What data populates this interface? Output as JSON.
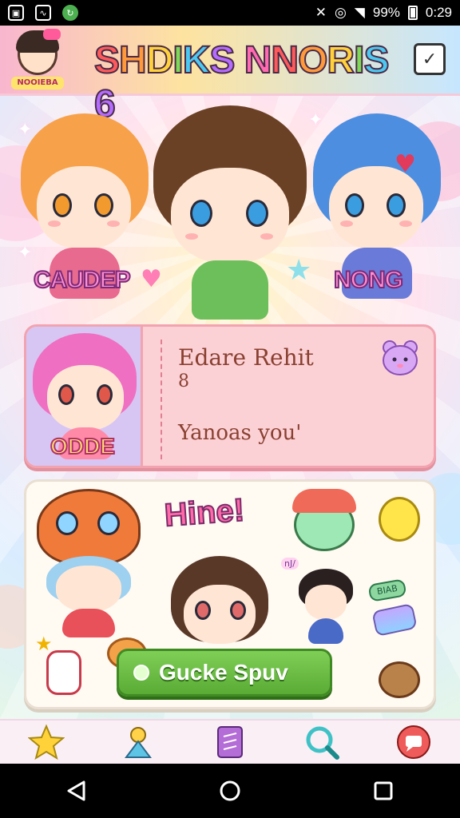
{
  "status_bar": {
    "battery": "99%",
    "time": "0:29",
    "icons": [
      "gallery-icon",
      "image-icon",
      "sync-icon",
      "mute-icon",
      "data-icon",
      "wifi-icon",
      "battery-icon"
    ]
  },
  "header": {
    "logo_text": "NOOIEBA",
    "title_letters": [
      "S",
      "H",
      "D",
      "I",
      "K",
      "S",
      " ",
      "N",
      "N",
      "O",
      "R",
      "I",
      "S",
      "6"
    ],
    "title_colors": [
      "#ff5a5a",
      "#ff9a3a",
      "#ffd23a",
      "#7ed957",
      "#4cc9f0",
      "#b46cff",
      "#ffffff",
      "#ff6ab0",
      "#ff5a5a",
      "#ff9a3a",
      "#ffd23a",
      "#7ed957",
      "#4cc9f0",
      "#b46cff"
    ],
    "action_icon": "checklist-icon"
  },
  "characters": [
    {
      "name": "CAUDEP",
      "hair": "#f7a24a",
      "eye": "#f29a2e",
      "outfit": "#e86a8f"
    },
    {
      "name": "",
      "hair": "#6b4126",
      "eye": "#3a9de0",
      "outfit": "#6cbf5a"
    },
    {
      "name": "NONG",
      "hair": "#4d8ee0",
      "eye": "#3a9de0",
      "outfit": "#6a7ad8"
    }
  ],
  "profile_card": {
    "name": "Edare Rehit",
    "number": "8",
    "message": "Yanoas you'",
    "badge": "ODDE",
    "avatar_hair": "#ef6fc2",
    "avatar_eye": "#e0584a"
  },
  "sticker_panel": {
    "header_text": "Hine!",
    "sticker_tag": "BIAB",
    "sticker_bubble": "nJ/",
    "button_label": "Gucke Spuv"
  },
  "bottom_nav": [
    {
      "icon": "star-icon",
      "color": "#ffd23a"
    },
    {
      "icon": "character-icon",
      "color": "#5ec4e6"
    },
    {
      "icon": "notes-icon",
      "color": "#b46cd6"
    },
    {
      "icon": "search-icon",
      "color": "#3fc2c6"
    },
    {
      "icon": "chat-icon",
      "color": "#ef5a5a"
    }
  ],
  "system_nav": [
    "back-icon",
    "home-icon",
    "recents-icon"
  ]
}
